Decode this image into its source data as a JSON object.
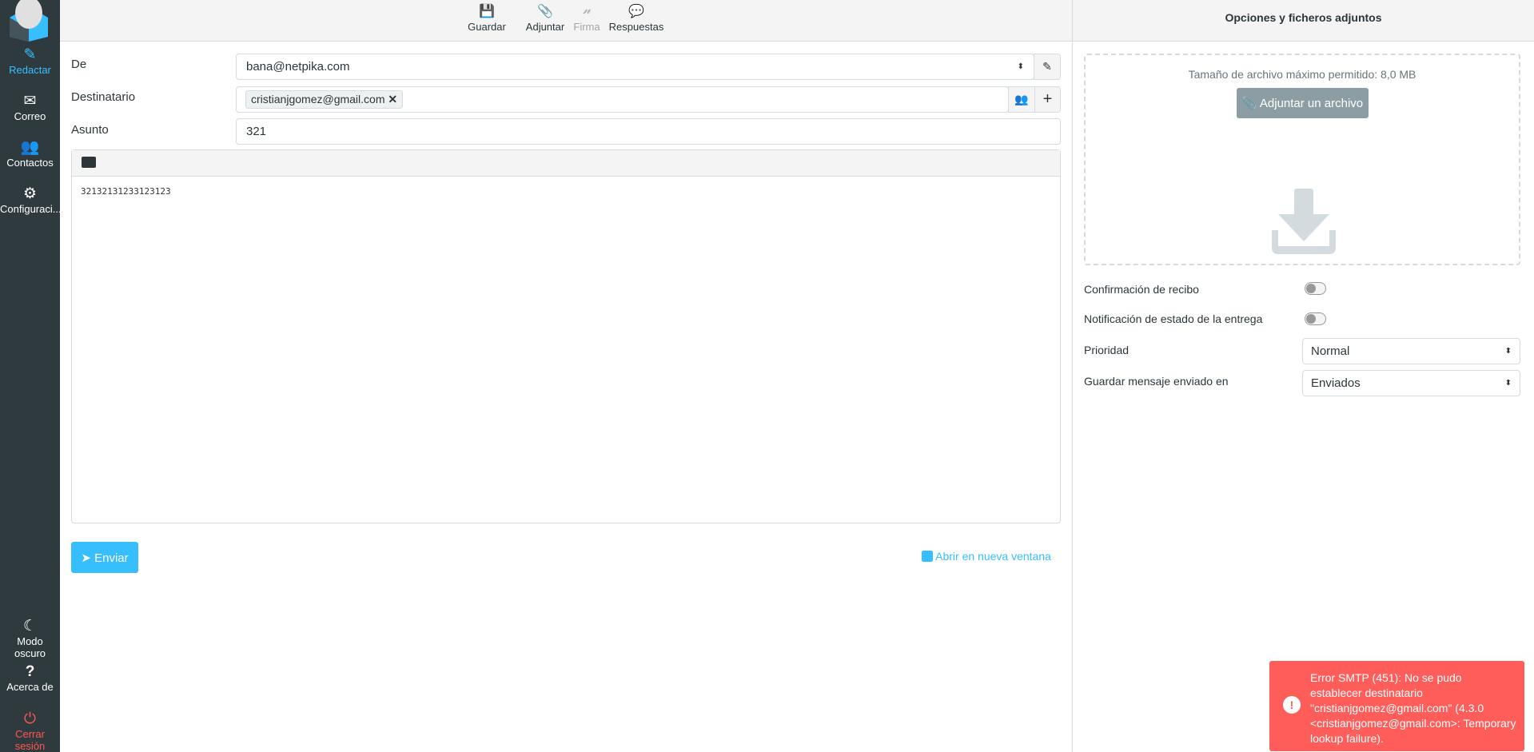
{
  "sidebar": {
    "items": [
      {
        "label": "Redactar",
        "icon": "compose-icon"
      },
      {
        "label": "Correo",
        "icon": "envelope-icon"
      },
      {
        "label": "Contactos",
        "icon": "users-icon"
      },
      {
        "label": "Configuraci...",
        "icon": "gear-icon"
      }
    ],
    "bottom": [
      {
        "label": "Modo oscuro",
        "icon": "moon-icon"
      },
      {
        "label": "Acerca de",
        "icon": "question-icon"
      },
      {
        "label": "Cerrar sesión",
        "icon": "power-icon"
      }
    ]
  },
  "toolbar": {
    "save": "Guardar",
    "attach": "Adjuntar",
    "signature": "Firma",
    "responses": "Respuestas"
  },
  "form": {
    "from_label": "De",
    "from_value": "bana@netpika.com",
    "to_label": "Destinatario",
    "recipient": "cristianjgomez@gmail.com",
    "subject_label": "Asunto",
    "subject_value": "321",
    "body": "32132131233123123"
  },
  "actions": {
    "send": "Enviar",
    "new_window": "Abrir en nueva ventana"
  },
  "options": {
    "title": "Opciones y ficheros adjuntos",
    "max_size": "Tamaño de archivo máximo permitido: 8,0 MB",
    "attach_button": "Adjuntar un archivo",
    "receipt_label": "Confirmación de recibo",
    "receipt_on": false,
    "dsn_label": "Notificación de estado de la entrega",
    "dsn_on": false,
    "priority_label": "Prioridad",
    "priority_value": "Normal",
    "save_label": "Guardar mensaje enviado en",
    "save_value": "Enviados"
  },
  "toast": {
    "message": "Error SMTP (451): No se pudo establecer destinatario \"cristianjgomez@gmail.com\" (4.3.0 <cristianjgomez@gmail.com>: Temporary lookup failure).",
    "color": "#ff5d5a"
  },
  "colors": {
    "accent": "#37beff",
    "sidebar": "#2f3a3f"
  }
}
